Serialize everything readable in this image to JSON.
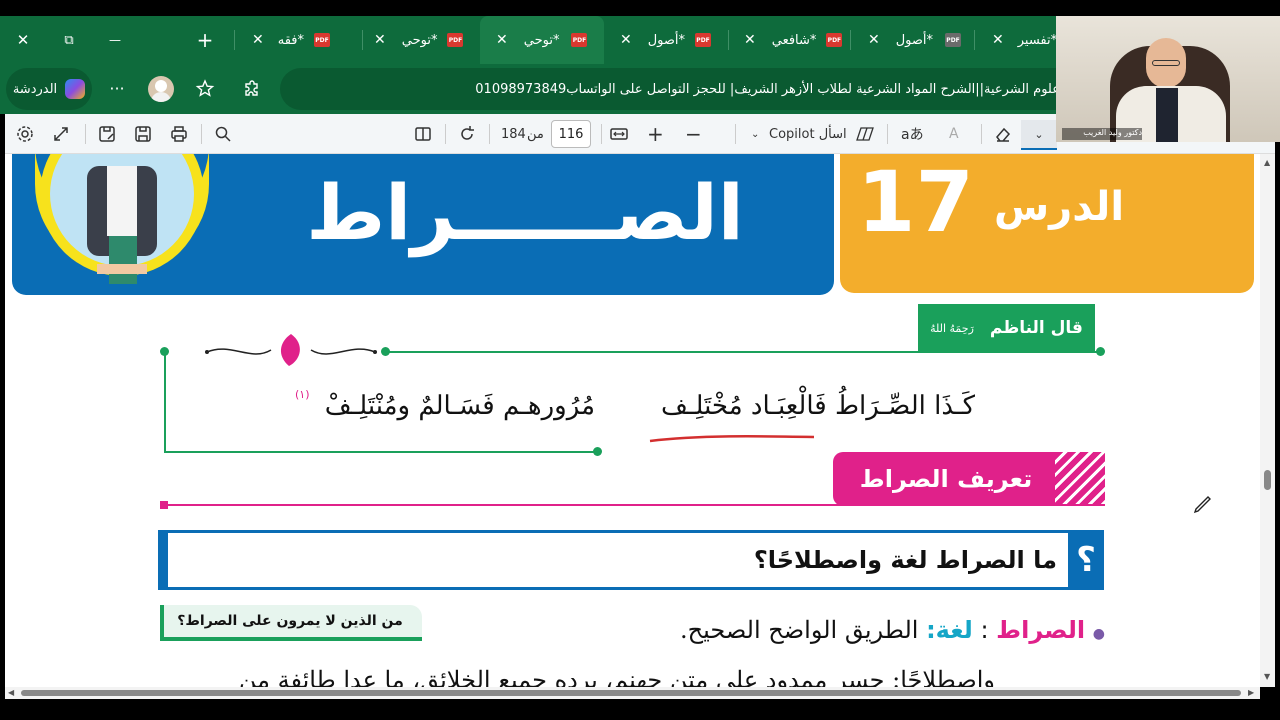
{
  "tabs": [
    {
      "title": "*تفسير",
      "active": false
    },
    {
      "title": "*أصول",
      "active": false
    },
    {
      "title": "*شافعي",
      "active": false
    },
    {
      "title": "*أصول",
      "active": false
    },
    {
      "title": "*توحي",
      "active": true
    },
    {
      "title": "*توحي",
      "active": false
    },
    {
      "title": "*فقه",
      "active": false
    }
  ],
  "pdf_badge": "PDF",
  "window": {
    "close": "✕",
    "restore": "⧉",
    "minimize": "—",
    "new_tab": "+"
  },
  "addressbar": {
    "chat_label": "الدردشة",
    "more": "···",
    "url_text": "علوم الشرعية||الشرح المواد الشرعية لطلاب الأزهر الشريف| للحجز التواصل على الواتساب01098973849"
  },
  "pdf_toolbar": {
    "page_current": "116",
    "page_of": "من",
    "page_total": "184",
    "zoom_in": "+",
    "zoom_out": "−",
    "ask_copilot": "اسأل Copilot",
    "read_aloud": "aあ",
    "text_size": "A"
  },
  "webcam": {
    "caption": "دكتور وليد الغريب"
  },
  "page": {
    "lesson_label": "الدرس",
    "lesson_number": "17",
    "lesson_title": "الصــــــراط",
    "nazim_label": "قال الناظم",
    "nazim_honorific": "رَحِمَهُ اللهُ",
    "verse_right": "كَـذَا الصِّـرَاطُ فَالْعِبَـاد مُخْتَلِـف",
    "verse_left": "مُرُورهـم فَسَـالمٌ ومُنْتَلِـفْ",
    "verse_footnote": "(١)",
    "section_title": "تعريف الصراط",
    "question_mark": "؟",
    "question": "ما الصراط لغة واصطلاحًا؟",
    "side_note": "من الذين لا يمرون على الصراط؟",
    "def_term": "الصراط",
    "def_colon": ":",
    "def_lang_label": "لغة:",
    "def_lang_text": "الطريق الواضح الصحيح.",
    "next_line": "واصطلاحًا: جسر ممدود على متن جهنم، يرده جميع الخلائق، ما عدا طائفة من"
  },
  "colors": {
    "edge_green": "#0e6b3c",
    "banner_blue": "#0a6db5",
    "banner_orange": "#f3ad2c",
    "green_label": "#1aa05b",
    "magenta": "#e0218a",
    "cyan": "#15a6c7"
  }
}
